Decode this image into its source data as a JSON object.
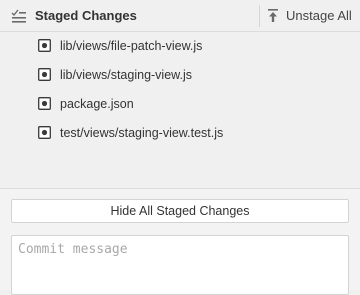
{
  "header": {
    "title": "Staged Changes",
    "unstage_all_label": "Unstage All",
    "icons": {
      "header": "list-check-icon",
      "unstage": "arrow-up-to-line-icon"
    }
  },
  "files": [
    {
      "path": "lib/views/file-patch-view.js",
      "status_icon": "file-modified-icon"
    },
    {
      "path": "lib/views/staging-view.js",
      "status_icon": "file-modified-icon"
    },
    {
      "path": "package.json",
      "status_icon": "file-modified-icon"
    },
    {
      "path": "test/views/staging-view.test.js",
      "status_icon": "file-modified-icon"
    }
  ],
  "hide_button_label": "Hide All Staged Changes",
  "commit": {
    "placeholder": "Commit message",
    "value": ""
  }
}
